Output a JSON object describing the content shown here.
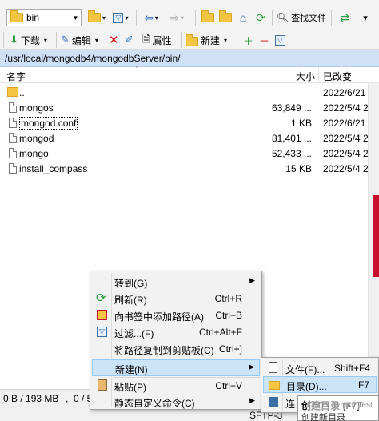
{
  "toolbar1": {
    "location_value": "bin",
    "find_files_label": "查找文件"
  },
  "toolbar2": {
    "download_label": "下载",
    "edit_label": "编辑",
    "properties_label": "属性",
    "new_label": "新建"
  },
  "path": "/usr/local/mongodb4/mongodbServer/bin/",
  "columns": {
    "name": "名字",
    "size": "大小",
    "modified": "已改变"
  },
  "files": [
    {
      "name": "..",
      "size": "",
      "date": "2022/6/21",
      "type": "parent"
    },
    {
      "name": "mongos",
      "size": "63,849 ...",
      "date": "2022/5/4 2",
      "type": "file"
    },
    {
      "name": "mongod.conf",
      "size": "1 KB",
      "date": "2022/6/21 1",
      "type": "file"
    },
    {
      "name": "mongod",
      "size": "81,401 ...",
      "date": "2022/5/4 2",
      "type": "file"
    },
    {
      "name": "mongo",
      "size": "52,433 ...",
      "date": "2022/5/4 2",
      "type": "file"
    },
    {
      "name": "install_compass",
      "size": "15 KB",
      "date": "2022/5/4 2",
      "type": "file"
    }
  ],
  "status": {
    "left": "0 B / 193 MB",
    "sep": ",",
    "count": "0 / 5",
    "sftp": "SFTP-3"
  },
  "context_menu": [
    {
      "label": "转到(G)",
      "shortcut": "",
      "submenu": true,
      "icon": ""
    },
    {
      "label": "刷新(R)",
      "shortcut": "Ctrl+R",
      "submenu": false,
      "icon": "refresh-icon"
    },
    {
      "label": "向书签中添加路径(A)",
      "shortcut": "Ctrl+B",
      "submenu": false,
      "icon": "bookmark-icon"
    },
    {
      "label": "过滤...(F)",
      "shortcut": "Ctrl+Alt+F",
      "submenu": false,
      "icon": "filter-icon"
    },
    {
      "label": "将路径复制到剪贴板(C)",
      "shortcut": "Ctrl+]",
      "submenu": false,
      "icon": ""
    },
    {
      "label": "新建(N)",
      "shortcut": "",
      "submenu": true,
      "icon": "",
      "highlighted": true
    },
    {
      "label": "粘贴(P)",
      "shortcut": "Ctrl+V",
      "submenu": false,
      "icon": "paste-icon"
    },
    {
      "label": "静态自定义命令(C)",
      "shortcut": "",
      "submenu": true,
      "icon": ""
    }
  ],
  "submenu": [
    {
      "label": "文件(F)...",
      "shortcut": "Shift+F4",
      "icon": "new-file-icon"
    },
    {
      "label": "目录(D)...",
      "shortcut": "F7",
      "icon": "new-folder-icon",
      "highlighted": true
    },
    {
      "label": "连",
      "shortcut": "",
      "icon": "link-icon"
    }
  ],
  "tooltip": {
    "title": "创建目录 (F7)",
    "body": "创建新目录"
  },
  "watermark": "CSDN @noobTest",
  "colors": {
    "path_bar": "#cfe0f7",
    "highlight": "#cce4f7",
    "folder": "#f4c542"
  }
}
